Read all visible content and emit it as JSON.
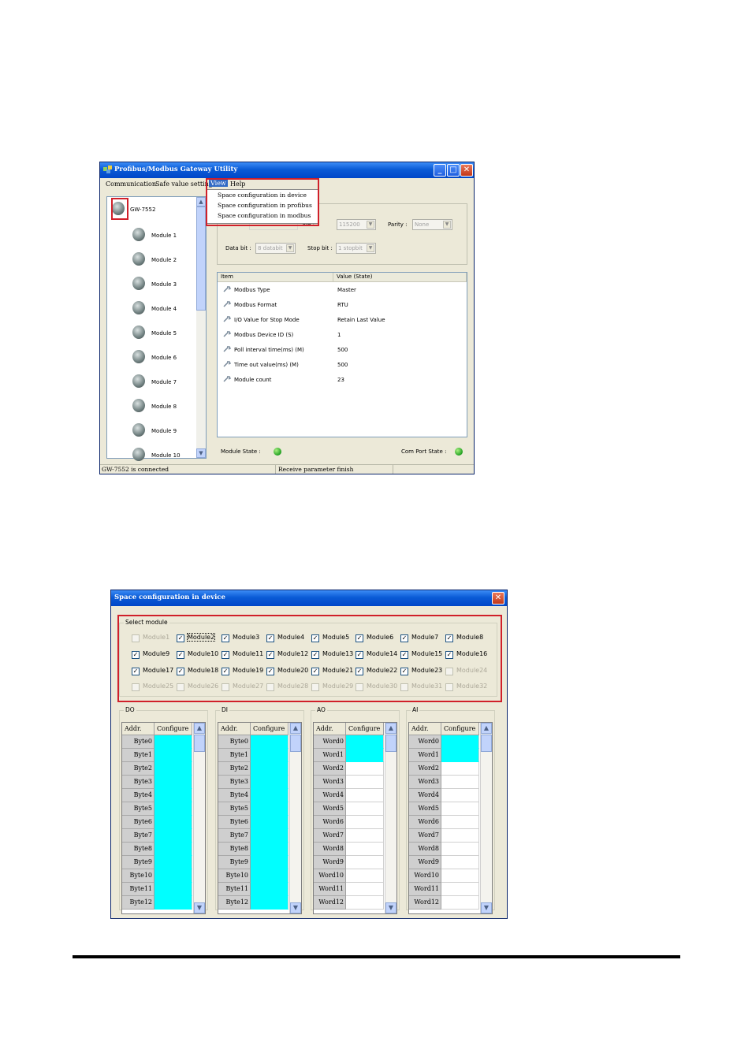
{
  "window1": {
    "title": "Profibus/Modbus Gateway Utility",
    "menu": [
      "Communication",
      "Safe value setting",
      "View",
      "Help"
    ],
    "view_menu_items": [
      "Space configuration in device",
      "Space configuration in profibus",
      "Space configuration in modbus"
    ],
    "tree": {
      "root": "GW-7552",
      "modules": [
        "Module 1",
        "Module 2",
        "Module 3",
        "Module 4",
        "Module 5",
        "Module 6",
        "Module 7",
        "Module 8",
        "Module 9",
        "Module 10"
      ]
    },
    "settings": {
      "baudrate_label": "ate :",
      "baudrate_value": "115200",
      "parity_label": "Parity :",
      "parity_value": "None",
      "databit_label": "Data bit :",
      "databit_value": "8 databit",
      "stopbit_label": "Stop bit :",
      "stopbit_value": "1 stopbit"
    },
    "param_list": {
      "columns": [
        "Item",
        "Value (State)"
      ],
      "rows": [
        {
          "item": "Modbus Type",
          "value": "Master"
        },
        {
          "item": "Modbus Format",
          "value": "RTU"
        },
        {
          "item": "I/O Value for Stop Mode",
          "value": "Retain Last Value"
        },
        {
          "item": "Modbus Device ID (S)",
          "value": "1"
        },
        {
          "item": "Poll interval time(ms) (M)",
          "value": "500"
        },
        {
          "item": "Time out value(ms) (M)",
          "value": "500"
        },
        {
          "item": "Module count",
          "value": "23"
        }
      ]
    },
    "module_state_label": "Module  State :",
    "com_port_state_label": "Com Port State :",
    "status_left": "GW-7552 is connected",
    "status_mid": "Receive parameter finish",
    "led_color": "#22aa22"
  },
  "window2": {
    "title": "Space configuration in device",
    "select_label": "Select module",
    "modules": [
      {
        "name": "Module1",
        "checked": false,
        "enabled": false
      },
      {
        "name": "Module2",
        "checked": true,
        "enabled": true
      },
      {
        "name": "Module3",
        "checked": true,
        "enabled": true
      },
      {
        "name": "Module4",
        "checked": true,
        "enabled": true
      },
      {
        "name": "Module5",
        "checked": true,
        "enabled": true
      },
      {
        "name": "Module6",
        "checked": true,
        "enabled": true
      },
      {
        "name": "Module7",
        "checked": true,
        "enabled": true
      },
      {
        "name": "Module8",
        "checked": true,
        "enabled": true
      },
      {
        "name": "Module9",
        "checked": true,
        "enabled": true
      },
      {
        "name": "Module10",
        "checked": true,
        "enabled": true
      },
      {
        "name": "Module11",
        "checked": true,
        "enabled": true
      },
      {
        "name": "Module12",
        "checked": true,
        "enabled": true
      },
      {
        "name": "Module13",
        "checked": true,
        "enabled": true
      },
      {
        "name": "Module14",
        "checked": true,
        "enabled": true
      },
      {
        "name": "Module15",
        "checked": true,
        "enabled": true
      },
      {
        "name": "Module16",
        "checked": true,
        "enabled": true
      },
      {
        "name": "Module17",
        "checked": true,
        "enabled": true
      },
      {
        "name": "Module18",
        "checked": true,
        "enabled": true
      },
      {
        "name": "Module19",
        "checked": true,
        "enabled": true
      },
      {
        "name": "Module20",
        "checked": true,
        "enabled": true
      },
      {
        "name": "Module21",
        "checked": true,
        "enabled": true
      },
      {
        "name": "Module22",
        "checked": true,
        "enabled": true
      },
      {
        "name": "Module23",
        "checked": true,
        "enabled": true
      },
      {
        "name": "Module24",
        "checked": false,
        "enabled": false
      },
      {
        "name": "Module25",
        "checked": false,
        "enabled": false
      },
      {
        "name": "Module26",
        "checked": false,
        "enabled": false
      },
      {
        "name": "Module27",
        "checked": false,
        "enabled": false
      },
      {
        "name": "Module28",
        "checked": false,
        "enabled": false
      },
      {
        "name": "Module29",
        "checked": false,
        "enabled": false
      },
      {
        "name": "Module30",
        "checked": false,
        "enabled": false
      },
      {
        "name": "Module31",
        "checked": false,
        "enabled": false
      },
      {
        "name": "Module32",
        "checked": false,
        "enabled": false
      }
    ],
    "grid_headers": [
      "Addr.",
      "Configure"
    ],
    "grids": [
      {
        "label": "DO",
        "rows": [
          "Byte0",
          "Byte1",
          "Byte2",
          "Byte3",
          "Byte4",
          "Byte5",
          "Byte6",
          "Byte7",
          "Byte8",
          "Byte9",
          "Byte10",
          "Byte11",
          "Byte12"
        ],
        "configured": 13
      },
      {
        "label": "DI",
        "rows": [
          "Byte0",
          "Byte1",
          "Byte2",
          "Byte3",
          "Byte4",
          "Byte5",
          "Byte6",
          "Byte7",
          "Byte8",
          "Byte9",
          "Byte10",
          "Byte11",
          "Byte12"
        ],
        "configured": 13
      },
      {
        "label": "AO",
        "rows": [
          "Word0",
          "Word1",
          "Word2",
          "Word3",
          "Word4",
          "Word5",
          "Word6",
          "Word7",
          "Word8",
          "Word9",
          "Word10",
          "Word11",
          "Word12"
        ],
        "configured": 2
      },
      {
        "label": "AI",
        "rows": [
          "Word0",
          "Word1",
          "Word2",
          "Word3",
          "Word4",
          "Word5",
          "Word6",
          "Word7",
          "Word8",
          "Word9",
          "Word10",
          "Word11",
          "Word12"
        ],
        "configured": 2
      }
    ],
    "configured_color": "#00ffff",
    "highlight_color": "#d0202a"
  }
}
